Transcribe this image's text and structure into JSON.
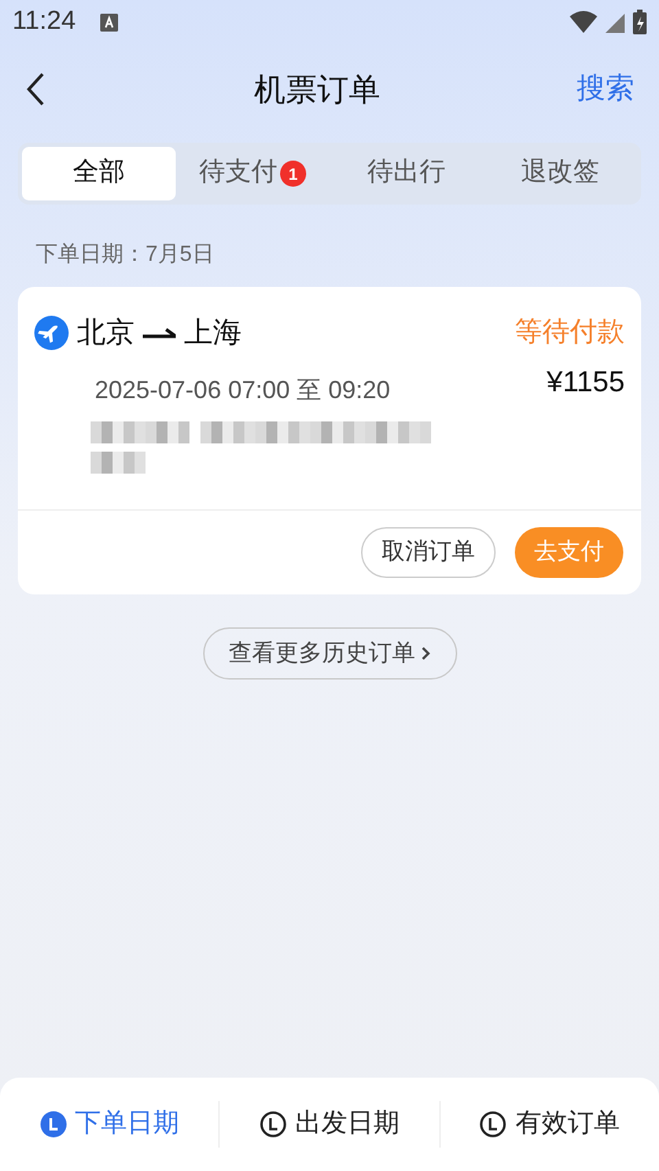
{
  "status_bar": {
    "time": "11:24"
  },
  "header": {
    "title": "机票订单",
    "action": "搜索"
  },
  "tabs": [
    {
      "label": "全部",
      "selected": true
    },
    {
      "label": "待支付",
      "selected": false,
      "badge": "1"
    },
    {
      "label": "待出行",
      "selected": false
    },
    {
      "label": "退改签",
      "selected": false
    }
  ],
  "groups": [
    {
      "date_label": "下单日期：7月5日",
      "orders": [
        {
          "route_from": "北京",
          "route_to": "上海",
          "status": "等待付款",
          "time": "2025-07-06 07:00 至 09:20",
          "price": "¥1155",
          "buttons": [
            {
              "label": "取消订单",
              "kind": "secondary"
            },
            {
              "label": "去支付",
              "kind": "primary"
            }
          ]
        }
      ]
    }
  ],
  "more_button": "查看更多历史订单",
  "sort_bar": [
    {
      "label": "下单日期",
      "selected": true
    },
    {
      "label": "出发日期",
      "selected": false
    },
    {
      "label": "有效订单",
      "selected": false
    }
  ]
}
